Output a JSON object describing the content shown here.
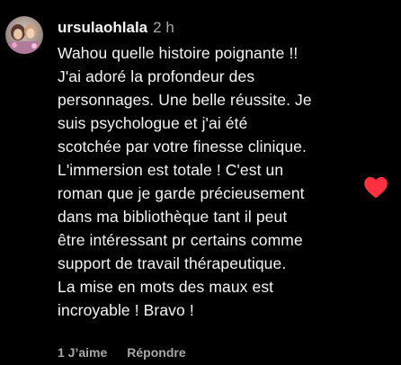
{
  "comment": {
    "username": "ursulaohlala",
    "time": "2 h",
    "text": "Wahou quelle histoire poignante !!\nJ'ai adoré la profondeur des\npersonnages. Une belle réussite. Je\nsuis psychologue et j'ai été\nscotchée par votre finesse clinique.\nL'immersion est totale ! C'est un\nroman que je garde précieusement\ndans ma bibliothèque tant il peut\nêtre intéressant pr certains comme\nsupport de travail thérapeutique.\nLa mise en mots des maux est\nincroyable ! Bravo !",
    "likes_label": "1 J’aime",
    "reply_label": "Répondre",
    "liked": true
  },
  "icons": {
    "like": "heart-icon",
    "avatar": "profile-avatar"
  },
  "colors": {
    "background": "#000000",
    "text": "#f5f5f5",
    "secondary": "#a8a8a8",
    "heart": "#ff3040"
  }
}
